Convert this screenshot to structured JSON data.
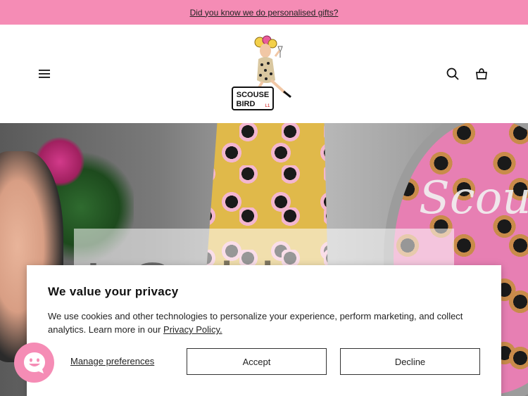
{
  "announcement": {
    "text": "Did you know we do personalised gifts?"
  },
  "header": {
    "logo_alt": "Scouse Bird",
    "logo_line1": "SCOUSE",
    "logo_line2": "BIRD",
    "logo_tag": "L1"
  },
  "hero": {
    "tin_text": "Scou",
    "overlay_text": "I Saida"
  },
  "cookie_banner": {
    "title": "We value your privacy",
    "body": "We use cookies and other technologies to personalize your experience, perform marketing, and collect analytics. Learn more in our ",
    "policy_link": "Privacy Policy.",
    "manage_label": "Manage preferences",
    "accept_label": "Accept",
    "decline_label": "Decline"
  },
  "icons": {
    "menu": "hamburger-menu-icon",
    "search": "search-icon",
    "cart": "shopping-bag-icon",
    "chat": "smiley-chat-icon"
  },
  "colors": {
    "accent_pink": "#f58cb5",
    "text": "#111111"
  }
}
